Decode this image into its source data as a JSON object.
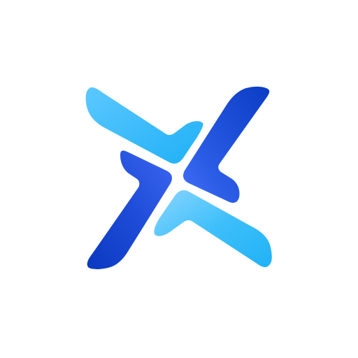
{
  "logo": {
    "icon": "pinwheel-x-logo-icon",
    "colors": {
      "light_blue": "#2FB8F8",
      "sky_blue": "#7FCFFF",
      "royal_blue": "#3657E8",
      "deep_blue": "#0B3FC9",
      "background": "#FFFFFF"
    }
  }
}
